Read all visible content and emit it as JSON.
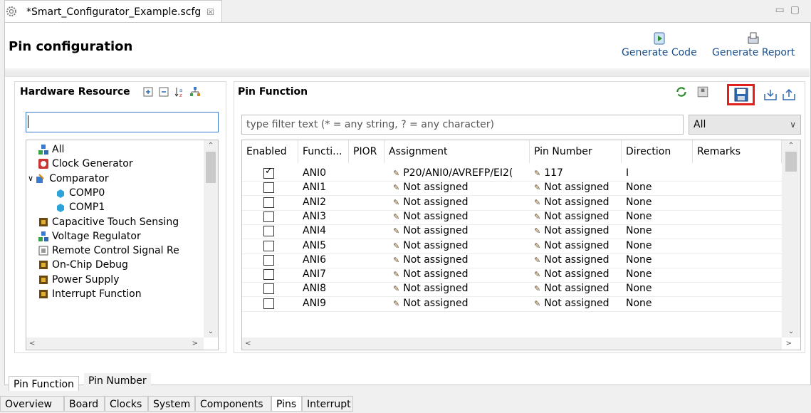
{
  "editor": {
    "tab_title": "*Smart_Configurator_Example.scfg",
    "tab_close": "☒",
    "page_title": "Pin configuration",
    "generate_code": "Generate Code",
    "generate_report": "Generate Report"
  },
  "hardware_resource": {
    "title": "Hardware Resource",
    "search_value": "",
    "items": [
      {
        "label": "All",
        "icon": "all-icon",
        "indent": 0,
        "expander": ""
      },
      {
        "label": "Clock Generator",
        "icon": "clock-icon",
        "indent": 0,
        "expander": ""
      },
      {
        "label": "Comparator",
        "icon": "comparator-icon",
        "indent": 0,
        "expander": "∨"
      },
      {
        "label": "COMP0",
        "icon": "module-icon",
        "indent": 1,
        "expander": ""
      },
      {
        "label": "COMP1",
        "icon": "module-icon",
        "indent": 1,
        "expander": ""
      },
      {
        "label": "Capacitive Touch Sensing",
        "icon": "chip-icon",
        "indent": 0,
        "expander": ""
      },
      {
        "label": "Voltage Regulator",
        "icon": "all-icon",
        "indent": 0,
        "expander": ""
      },
      {
        "label": "Remote Control Signal Re",
        "icon": "remote-icon",
        "indent": 0,
        "expander": ""
      },
      {
        "label": "On-Chip Debug",
        "icon": "chip-icon",
        "indent": 0,
        "expander": ""
      },
      {
        "label": "Power Supply",
        "icon": "chip-icon",
        "indent": 0,
        "expander": ""
      },
      {
        "label": "Interrupt Function",
        "icon": "chip-icon",
        "indent": 0,
        "expander": ""
      }
    ]
  },
  "pin_function": {
    "title": "Pin Function",
    "filter_placeholder": "type filter text (* = any string, ? = any character)",
    "filter_select": "All",
    "columns": [
      "Enabled",
      "Functi...",
      "PIOR",
      "Assignment",
      "Pin Number",
      "Direction",
      "Remarks"
    ],
    "rows": [
      {
        "enabled": true,
        "function": "ANI0",
        "pior": "",
        "assignment": "P20/ANI0/AVREFP/EI2(",
        "pin": "117",
        "direction": "I",
        "remarks": ""
      },
      {
        "enabled": false,
        "function": "ANI1",
        "pior": "",
        "assignment": "Not assigned",
        "pin": "Not assigned",
        "direction": "None",
        "remarks": ""
      },
      {
        "enabled": false,
        "function": "ANI2",
        "pior": "",
        "assignment": "Not assigned",
        "pin": "Not assigned",
        "direction": "None",
        "remarks": ""
      },
      {
        "enabled": false,
        "function": "ANI3",
        "pior": "",
        "assignment": "Not assigned",
        "pin": "Not assigned",
        "direction": "None",
        "remarks": ""
      },
      {
        "enabled": false,
        "function": "ANI4",
        "pior": "",
        "assignment": "Not assigned",
        "pin": "Not assigned",
        "direction": "None",
        "remarks": ""
      },
      {
        "enabled": false,
        "function": "ANI5",
        "pior": "",
        "assignment": "Not assigned",
        "pin": "Not assigned",
        "direction": "None",
        "remarks": ""
      },
      {
        "enabled": false,
        "function": "ANI6",
        "pior": "",
        "assignment": "Not assigned",
        "pin": "Not assigned",
        "direction": "None",
        "remarks": ""
      },
      {
        "enabled": false,
        "function": "ANI7",
        "pior": "",
        "assignment": "Not assigned",
        "pin": "Not assigned",
        "direction": "None",
        "remarks": ""
      },
      {
        "enabled": false,
        "function": "ANI8",
        "pior": "",
        "assignment": "Not assigned",
        "pin": "Not assigned",
        "direction": "None",
        "remarks": ""
      },
      {
        "enabled": false,
        "function": "ANI9",
        "pior": "",
        "assignment": "Not assigned",
        "pin": "Not assigned",
        "direction": "None",
        "remarks": ""
      }
    ]
  },
  "view_tabs": [
    "Pin Function",
    "Pin Number"
  ],
  "editor_tabs": [
    "Overview",
    "Board",
    "Clocks",
    "System",
    "Components",
    "Pins",
    "Interrupt"
  ],
  "colors": {
    "highlight": "#e0201c",
    "link": "#1b4f8a",
    "focus": "#3a7ad0"
  }
}
